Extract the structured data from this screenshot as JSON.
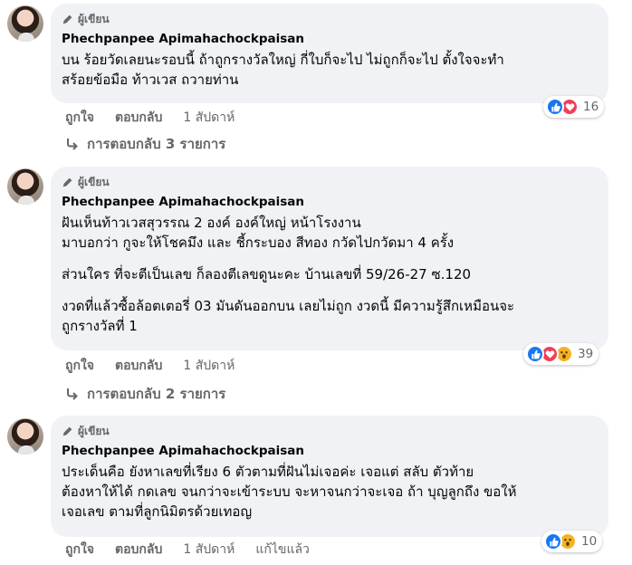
{
  "comments": [
    {
      "badge": "ผู้เขียน",
      "author": "Phechpanpee Apimahachockpaisan",
      "paragraphs": [
        "บน ร้อยวัดเลยนะรอบนี้ ถ้าถูกรางวัลใหญ่ กี่ใบก็จะไป ไม่ถูกก็จะไป ตั้งใจจะทำ\nสร้อยข้อมือ ท้าวเวส ถวายท่าน"
      ],
      "reactions": [
        "like",
        "love"
      ],
      "reaction_count": "16",
      "actions": {
        "like": "ถูกใจ",
        "reply": "ตอบกลับ",
        "time": "1 สัปดาห์"
      },
      "replies_label": "การตอบกลับ 3 รายการ"
    },
    {
      "badge": "ผู้เขียน",
      "author": "Phechpanpee Apimahachockpaisan",
      "paragraphs": [
        "ฝันเห็นท้าวเวสสุวรรณ 2 องค์ องค์ใหญ่ หน้าโรงงาน\nมาบอกว่า กูจะให้โชคมึง และ ชี้กระบอง สีทอง กวัดไปกวัดมา 4 ครั้ง",
        "ส่วนใคร ที่จะตีเป็นเลข ก็ลองตีเลขดูนะคะ บ้านเลขที่ 59/26-27 ซ.120",
        "งวดที่แล้วซื้อล้อตเตอรี่ 03 มันดันออกบน เลยไม่ถูก งวดนี้ มีความรู้สึกเหมือนจะ\nถูกรางวัลที่ 1"
      ],
      "reactions": [
        "like",
        "love",
        "wow"
      ],
      "reaction_count": "39",
      "actions": {
        "like": "ถูกใจ",
        "reply": "ตอบกลับ",
        "time": "1 สัปดาห์"
      },
      "replies_label": "การตอบกลับ 2 รายการ"
    },
    {
      "badge": "ผู้เขียน",
      "author": "Phechpanpee Apimahachockpaisan",
      "paragraphs": [
        "ประเด็นคือ ยังหาเลขที่เรียง 6 ตัวตามที่ฝันไม่เจอค่ะ เจอแต่ สลับ ตัวท้าย\nต้องหาให้ได้ กดเลข จนกว่าจะเข้าระบบ จะหาจนกว่าจะเจอ ถ้า บุญลูกถึง ขอให้\nเจอเลข ตามที่ลูกนิมิตรด้วยเทอญ"
      ],
      "reactions": [
        "like",
        "wow"
      ],
      "reaction_count": "10",
      "actions": {
        "like": "ถูกใจ",
        "reply": "ตอบกลับ",
        "time": "1 สัปดาห์",
        "edited": "แก้ไขแล้ว"
      }
    }
  ],
  "colors": {
    "bubble": "#f0f2f5",
    "like": "#1877f2",
    "love": "#f33e58",
    "wow": "#f7b125",
    "secondary_text": "#65676b"
  },
  "icons": {
    "badge": "pencil-icon",
    "reply": "reply-arrow-icon"
  }
}
